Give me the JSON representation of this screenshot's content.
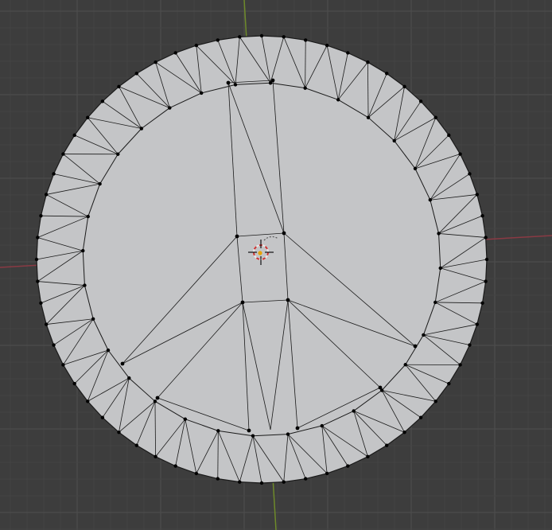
{
  "viewport": {
    "background_color": "#3d3d3d",
    "grid_minor_color": "#444444",
    "grid_major_color": "#4e4e4e",
    "axis_x_color": "#8a3a44",
    "axis_y_color": "#6e8a2a"
  },
  "mesh": {
    "face_color": "#c4c5c7",
    "edge_color": "#1a1a1a",
    "vertex_color": "#000000",
    "outer_ring_segments": 64,
    "inner_ring_segments": 32
  },
  "cursor_3d": {
    "name": "3d-cursor-icon",
    "ring_color_a": "#e8e8e8",
    "ring_color_b": "#cc3333"
  },
  "origin_marker": {
    "name": "object-origin-icon",
    "color": "#e8a200"
  },
  "gizmo": {
    "name": "transform-gizmo-icon",
    "color": "#555555"
  }
}
